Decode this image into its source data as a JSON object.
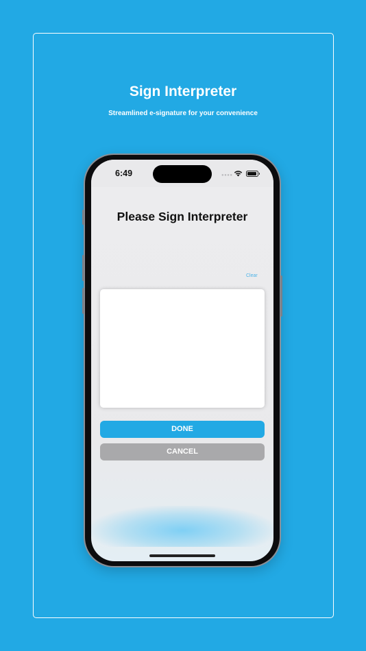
{
  "promo": {
    "title": "Sign Interpreter",
    "subtitle": "Streamlined e-signature for your convenience"
  },
  "status_bar": {
    "time": "6:49",
    "icons": [
      "cellular-icon",
      "wifi-icon",
      "battery-icon"
    ]
  },
  "screen": {
    "title": "Please Sign Interpreter",
    "clear_label": "Clear",
    "done_label": "DONE",
    "cancel_label": "CANCEL"
  },
  "colors": {
    "background": "#22a9e4",
    "accent": "#22a9e4",
    "cancel": "#a9a9ab",
    "link": "#4bb3e8"
  }
}
